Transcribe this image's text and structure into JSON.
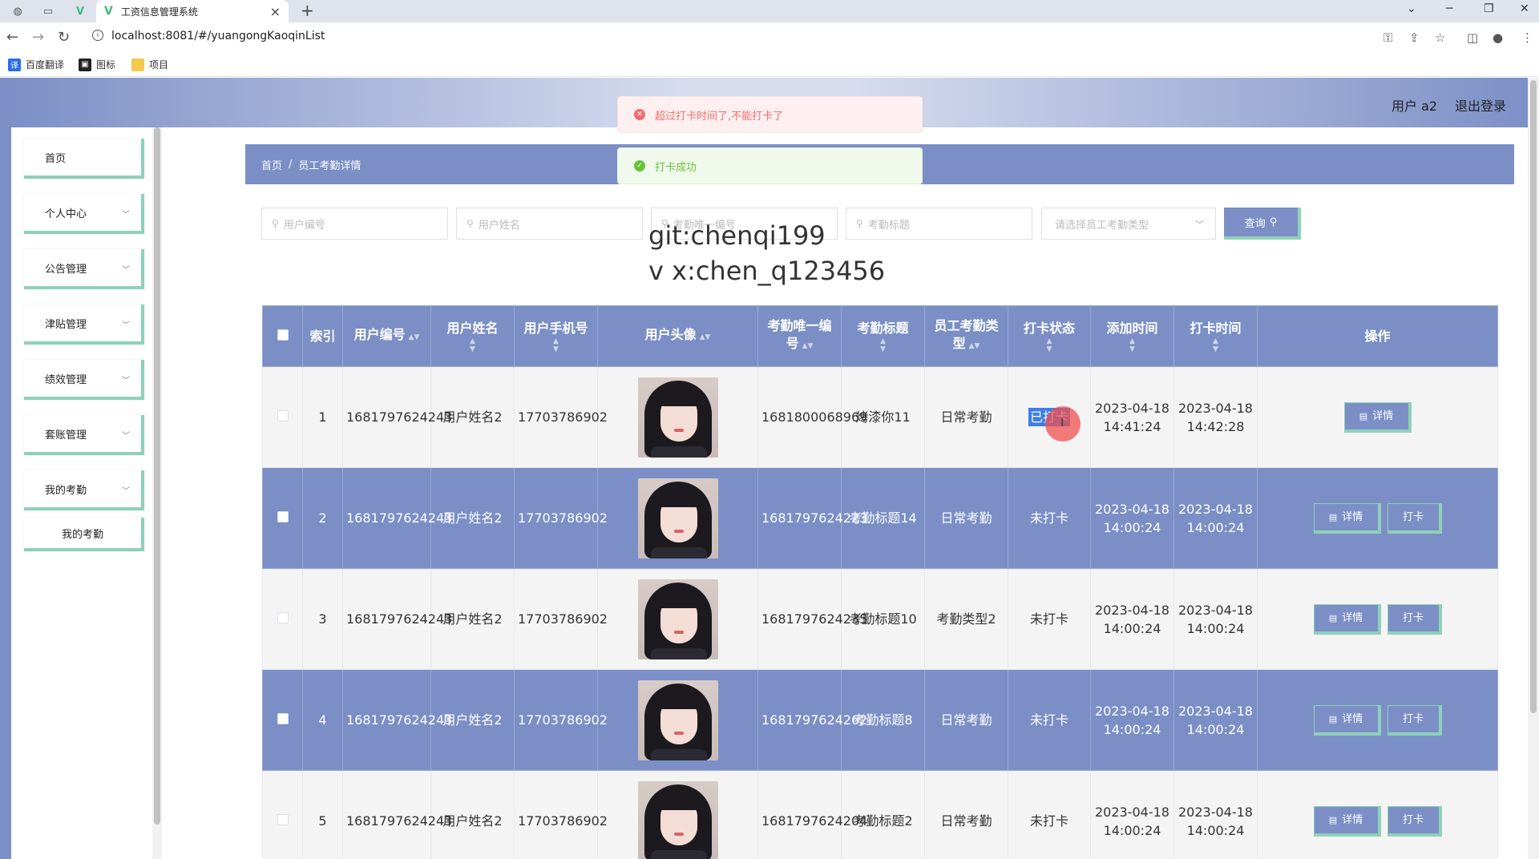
{
  "browser": {
    "tab_title": "工资信息管理系统",
    "tab_logo": "V",
    "url": "localhost:8081/#/yuangongKaoqinList",
    "bookmarks": [
      "百度翻译",
      "图标",
      "项目"
    ]
  },
  "header": {
    "user_label": "用户 a2",
    "logout_label": "退出登录"
  },
  "sidebar": {
    "items": [
      {
        "label": "首页"
      },
      {
        "label": "个人中心"
      },
      {
        "label": "公告管理"
      },
      {
        "label": "津贴管理"
      },
      {
        "label": "绩效管理"
      },
      {
        "label": "套账管理"
      },
      {
        "label": "我的考勤"
      }
    ],
    "sub_item": "我的考勤"
  },
  "breadcrumb": {
    "home": "首页",
    "separator": "/",
    "current": "员工考勤详情"
  },
  "search": {
    "placeholders": [
      "用户编号",
      "用户姓名",
      "考勤唯一编号",
      "考勤标题"
    ],
    "select_placeholder": "请选择员工考勤类型",
    "query_label": "查询"
  },
  "watermark": {
    "line1": "git:chenqi199",
    "line2": "v x:chen_q123456"
  },
  "toasts": {
    "error": "超过打卡时间了,不能打卡了",
    "success": "打卡成功"
  },
  "table": {
    "headers": [
      "索引",
      "用户编号",
      "用户姓名",
      "用户手机号",
      "用户头像",
      "考勤唯一编号",
      "考勤标题",
      "员工考勤类型",
      "打卡状态",
      "添加时间",
      "打卡时间",
      "操作"
    ],
    "actions": {
      "detail": "详情",
      "punch": "打卡"
    },
    "rows": [
      {
        "index": "1",
        "user_no": "1681797624243",
        "name": "用户姓名2",
        "phone": "17703786902",
        "kq_no": "1681800068969",
        "title": "烤漆你11",
        "type": "日常考勤",
        "status": "已打卡",
        "added": "2023-04-18 14:41:24",
        "punched": "2023-04-18 14:42:28"
      },
      {
        "index": "2",
        "user_no": "1681797624243",
        "name": "用户姓名2",
        "phone": "17703786902",
        "kq_no": "1681797624223",
        "title": "考勤标题14",
        "type": "日常考勤",
        "status": "未打卡",
        "added": "2023-04-18 14:00:24",
        "punched": "2023-04-18 14:00:24"
      },
      {
        "index": "3",
        "user_no": "1681797624243",
        "name": "用户姓名2",
        "phone": "17703786902",
        "kq_no": "1681797624235",
        "title": "考勤标题10",
        "type": "考勤类型2",
        "status": "未打卡",
        "added": "2023-04-18 14:00:24",
        "punched": "2023-04-18 14:00:24"
      },
      {
        "index": "4",
        "user_no": "1681797624243",
        "name": "用户姓名2",
        "phone": "17703786902",
        "kq_no": "1681797624262",
        "title": "考勤标题8",
        "type": "日常考勤",
        "status": "未打卡",
        "added": "2023-04-18 14:00:24",
        "punched": "2023-04-18 14:00:24"
      },
      {
        "index": "5",
        "user_no": "1681797624243",
        "name": "用户姓名2",
        "phone": "17703786902",
        "kq_no": "1681797624204",
        "title": "考勤标题2",
        "type": "日常考勤",
        "status": "未打卡",
        "added": "2023-04-18 14:00:24",
        "punched": "2023-04-18 14:00:24"
      }
    ]
  },
  "colors": {
    "primary": "#7b8fc6",
    "accent_border": "#8ed1b8",
    "error": "#f56c6c",
    "success": "#67c23a"
  }
}
